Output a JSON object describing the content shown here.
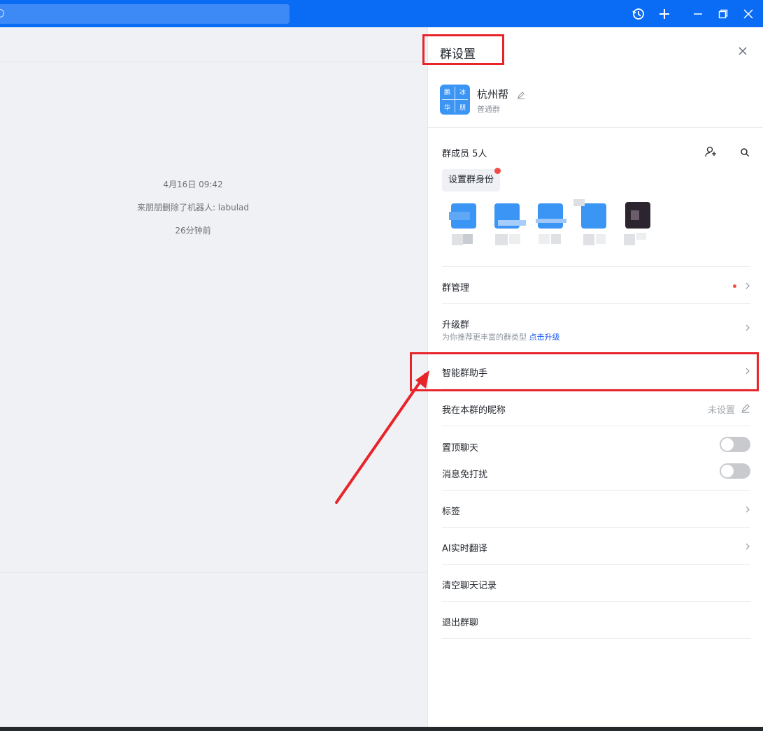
{
  "chat": {
    "messages": [
      "4月16日 09:42",
      "来朋朋删除了机器人: labulad",
      "26分钟前"
    ]
  },
  "panel": {
    "title": "群设置",
    "group": {
      "avatar_chars": [
        "鹏",
        "冰",
        "华",
        "朋"
      ],
      "name": "杭州帮",
      "type": "普通群"
    },
    "members": {
      "title": "群成员 5人",
      "role_button": "设置群身份"
    },
    "rows": {
      "manage": "群管理",
      "upgrade": "升级群",
      "upgrade_sub": "为你推荐更丰富的群类型",
      "upgrade_link": "点击升级",
      "assistant": "智能群助手",
      "nickname": "我在本群的昵称",
      "nickname_value": "未设置",
      "pin": "置顶聊天",
      "mute": "消息免打扰",
      "tags": "标签",
      "translate": "AI实时翻译",
      "clear": "清空聊天记录",
      "quit": "退出群聊"
    },
    "toggles": {
      "pin_on": false,
      "mute_on": false
    }
  },
  "colors": {
    "titlebar": "#0a6cf5",
    "annotation": "#e8242b",
    "link": "#1456f0"
  }
}
